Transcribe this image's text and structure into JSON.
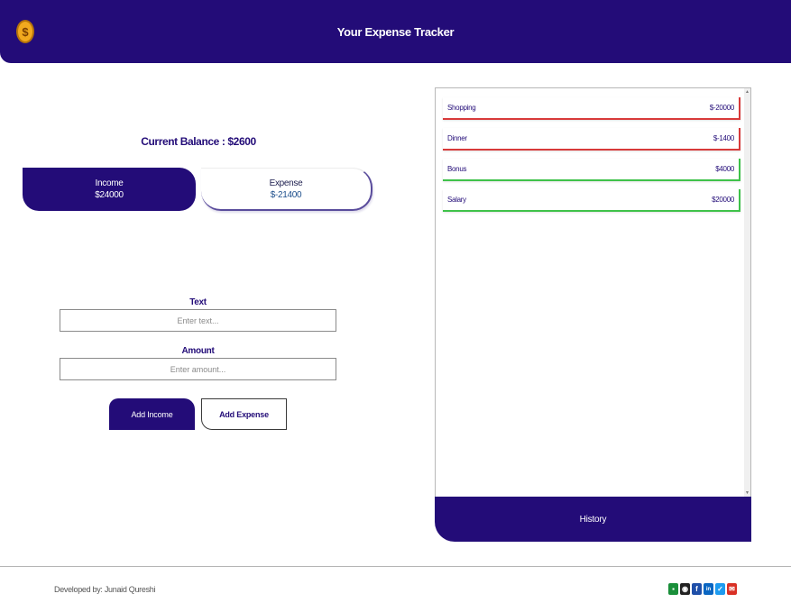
{
  "header": {
    "title": "Your Expense Tracker",
    "logo_icon": "dollar-coin-icon",
    "logo_glyph": "$",
    "background": "#230c78"
  },
  "balance": {
    "text": "Current Balance : $2600"
  },
  "summary": {
    "income_label": "Income",
    "income_value": "$24000",
    "expense_label": "Expense",
    "expense_value": "$-21400"
  },
  "form": {
    "text_label": "Text",
    "text_placeholder": "Enter text...",
    "amount_label": "Amount",
    "amount_placeholder": "Enter amount...",
    "add_income_label": "Add Income",
    "add_expense_label": "Add Expense"
  },
  "history": {
    "label": "History",
    "transactions": [
      {
        "name": "Shopping",
        "amount": "$-20000",
        "type": "expense"
      },
      {
        "name": "Dinner",
        "amount": "$-1400",
        "type": "expense"
      },
      {
        "name": "Bonus",
        "amount": "$4000",
        "type": "income"
      },
      {
        "name": "Salary",
        "amount": "$20000",
        "type": "income"
      }
    ],
    "expense_color": "#d83a3a",
    "income_color": "#3fc24a"
  },
  "footer": {
    "credit": "Developed by: Junaid Qureshi",
    "socials": [
      {
        "icon": "contact-card-icon",
        "glyph": "▪",
        "color": "#1a8f3a"
      },
      {
        "icon": "github-icon",
        "glyph": "◉",
        "color": "#222222"
      },
      {
        "icon": "facebook-icon",
        "glyph": "f",
        "color": "#1f4fa8"
      },
      {
        "icon": "linkedin-icon",
        "glyph": "in",
        "color": "#0a66c2"
      },
      {
        "icon": "twitter-icon",
        "glyph": "✓",
        "color": "#1d9bf0"
      },
      {
        "icon": "email-icon",
        "glyph": "✉",
        "color": "#d93025"
      }
    ]
  }
}
